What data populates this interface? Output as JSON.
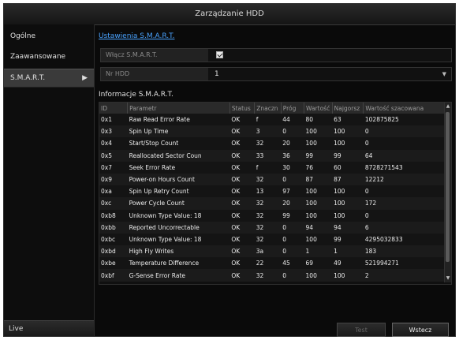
{
  "title": "Zarządzanie HDD",
  "sidebar": {
    "items": [
      {
        "label": "Ogólne"
      },
      {
        "label": "Zaawansowane"
      },
      {
        "label": "S.M.A.R.T."
      }
    ],
    "live_label": "Live"
  },
  "breadcrumb": "Ustawienia S.M.A.R.T.",
  "smart_toggle": {
    "label": "Włącz S.M.A.R.T.",
    "checked": true
  },
  "hdd_select": {
    "label": "Nr HDD",
    "value": "1"
  },
  "info_title": "Informacje S.M.A.R.T.",
  "table": {
    "headers": [
      "ID",
      "Parametr",
      "Status",
      "Znaczn",
      "Próg",
      "Wartość",
      "Najgorsz",
      "Wartość szacowana"
    ],
    "rows": [
      [
        "0x1",
        "Raw Read Error Rate",
        "OK",
        "f",
        "44",
        "80",
        "63",
        "102875825"
      ],
      [
        "0x3",
        "Spin Up Time",
        "OK",
        "3",
        "0",
        "100",
        "100",
        "0"
      ],
      [
        "0x4",
        "Start/Stop Count",
        "OK",
        "32",
        "20",
        "100",
        "100",
        "0"
      ],
      [
        "0x5",
        "Reallocated Sector Coun",
        "OK",
        "33",
        "36",
        "99",
        "99",
        "64"
      ],
      [
        "0x7",
        "Seek Error Rate",
        "OK",
        "f",
        "30",
        "76",
        "60",
        "8728271543"
      ],
      [
        "0x9",
        "Power-on Hours Count",
        "OK",
        "32",
        "0",
        "87",
        "87",
        "12212"
      ],
      [
        "0xa",
        "Spin Up Retry Count",
        "OK",
        "13",
        "97",
        "100",
        "100",
        "0"
      ],
      [
        "0xc",
        "Power Cycle Count",
        "OK",
        "32",
        "20",
        "100",
        "100",
        "172"
      ],
      [
        "0xb8",
        "Unknown Type Value: 18",
        "OK",
        "32",
        "99",
        "100",
        "100",
        "0"
      ],
      [
        "0xbb",
        "Reported Uncorrectable",
        "OK",
        "32",
        "0",
        "94",
        "94",
        "6"
      ],
      [
        "0xbc",
        "Unknown Type Value: 18",
        "OK",
        "32",
        "0",
        "100",
        "99",
        "4295032833"
      ],
      [
        "0xbd",
        "High Fly Writes",
        "OK",
        "3a",
        "0",
        "1",
        "1",
        "183"
      ],
      [
        "0xbe",
        "Temperature Difference",
        "OK",
        "22",
        "45",
        "69",
        "49",
        "521994271"
      ],
      [
        "0xbf",
        "G-Sense Error Rate",
        "OK",
        "32",
        "0",
        "100",
        "100",
        "2"
      ]
    ]
  },
  "buttons": {
    "test": "Test",
    "back": "Wstecz"
  }
}
